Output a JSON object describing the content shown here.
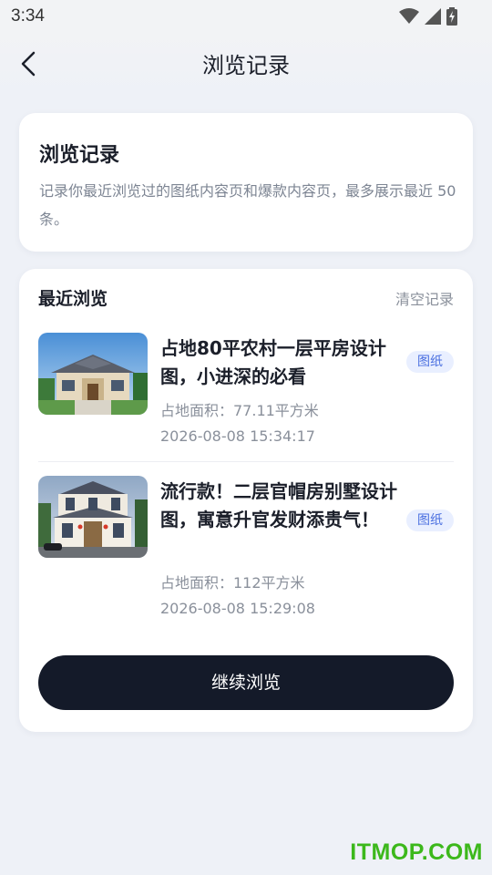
{
  "status_bar": {
    "time": "3:34",
    "icons": [
      "wifi-icon",
      "signal-icon",
      "battery-charging-icon"
    ]
  },
  "nav": {
    "back_icon": "chevron-left-icon",
    "title": "浏览记录"
  },
  "intro": {
    "title": "浏览记录",
    "description": "记录你最近浏览过的图纸内容页和爆款内容页，最多展示最近 50 条。"
  },
  "recent": {
    "section_title": "最近浏览",
    "clear_label": "清空记录",
    "items": [
      {
        "title": "占地80平农村一层平房设计图，小进深的必看",
        "tag": "图纸",
        "area": "占地面积：77.11平方米",
        "time": "2026-08-08 15:34:17"
      },
      {
        "title": "流行款！二层官帽房别墅设计图，寓意升官发财添贵气！",
        "tag": "图纸",
        "area": "占地面积：112平方米",
        "time": "2026-08-08 15:29:08"
      }
    ]
  },
  "continue_label": "继续浏览",
  "watermark": "ITMOP.COM",
  "colors": {
    "background": "#eef1f7",
    "primary_button": "#141a29",
    "tag_bg": "#e9efff",
    "tag_text": "#4a6fe0",
    "watermark": "#3cb81b"
  }
}
